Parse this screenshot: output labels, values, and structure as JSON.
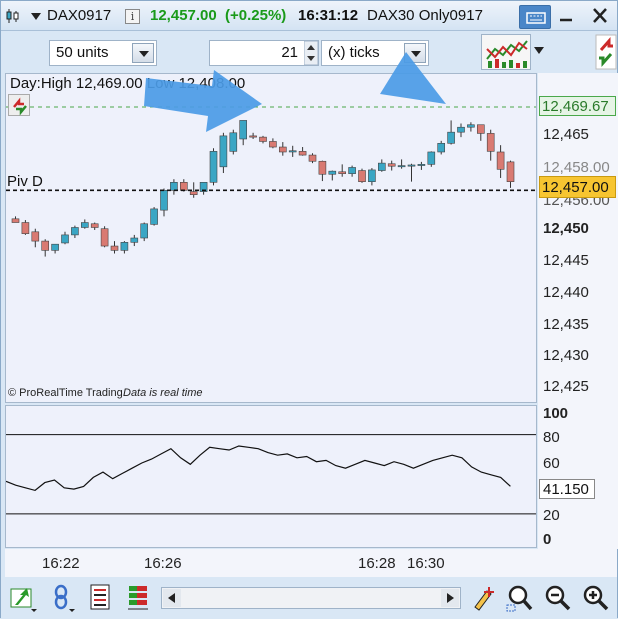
{
  "header": {
    "instrument": "DAX0917",
    "info_icon": "i",
    "price": "12,457.00",
    "change": "(+0.25%)",
    "time": "16:31:12",
    "description": "DAX30 Only0917"
  },
  "toolbar": {
    "units": "50 units",
    "ticks_value": "21",
    "ticks_mode": "(x) ticks"
  },
  "chart": {
    "day_info": "Day:High 12,469.00 Low 12,408.00",
    "piv_label": "Piv D",
    "copyright": "© ProRealTime Trading",
    "realtime": "Data is real time",
    "high_tag": "12,469.67",
    "last_tag": "12,457.00",
    "hidden_tags": [
      "12,458.00",
      "12,456.00"
    ],
    "price_ticks": [
      "12,465",
      "12,450",
      "12,445",
      "12,440",
      "12,435",
      "12,430",
      "12,425"
    ],
    "indicator_ticks": [
      "100",
      "80",
      "60",
      "20",
      "0"
    ],
    "indicator_value": "41.150",
    "time_ticks": [
      "16:22",
      "16:26",
      "16:28",
      "16:30"
    ]
  },
  "colors": {
    "up": "#3aa6c4",
    "down": "#d97a72",
    "accent_green": "#1a9a1a",
    "tag_yellow": "#f7c531",
    "arrow_blue": "#4b9be6"
  },
  "chart_data": {
    "type": "candlestick",
    "ylim": [
      12422,
      12475
    ],
    "high_line": 12469.67,
    "pivot": 12456.2,
    "candles": [
      [
        12451.6,
        12452,
        12451,
        12451
      ],
      [
        12451,
        12451.4,
        12449,
        12449.2
      ],
      [
        12449.5,
        12450,
        12447,
        12448
      ],
      [
        12448,
        12448.3,
        12445.5,
        12446.5
      ],
      [
        12446.5,
        12447.5,
        12446,
        12447.5
      ],
      [
        12447.7,
        12449.5,
        12447.5,
        12449
      ],
      [
        12449,
        12450.5,
        12448.5,
        12450.2
      ],
      [
        12450.2,
        12451.5,
        12450,
        12451
      ],
      [
        12450.8,
        12451,
        12449.8,
        12450.2
      ],
      [
        12450,
        12450.4,
        12447,
        12447.2
      ],
      [
        12447.2,
        12448,
        12446,
        12446.5
      ],
      [
        12446.5,
        12448,
        12446,
        12447.8
      ],
      [
        12447.8,
        12449,
        12447.2,
        12448.5
      ],
      [
        12448.5,
        12451,
        12448,
        12450.8
      ],
      [
        12450.7,
        12453.5,
        12450.5,
        12453.2
      ],
      [
        12453,
        12456.5,
        12452,
        12456.2
      ],
      [
        12456.2,
        12458,
        12455.5,
        12457.5
      ],
      [
        12457.5,
        12458,
        12456,
        12456.2
      ],
      [
        12456,
        12457.5,
        12455,
        12455.5
      ],
      [
        12456,
        12457.5,
        12455.5,
        12457.5
      ],
      [
        12457.5,
        12463,
        12457,
        12462.5
      ],
      [
        12460,
        12465.5,
        12459,
        12465
      ],
      [
        12462.5,
        12466,
        12462,
        12465.5
      ],
      [
        12464.5,
        12467.5,
        12463.5,
        12467.5
      ],
      [
        12465,
        12465.5,
        12464.5,
        12464.8
      ],
      [
        12464.8,
        12465,
        12463.8,
        12464.1
      ],
      [
        12464.1,
        12464.6,
        12463,
        12463.2
      ],
      [
        12463.2,
        12464,
        12461.8,
        12462.4
      ],
      [
        12462.4,
        12463.4,
        12461.6,
        12462.6
      ],
      [
        12462.5,
        12463.2,
        12461.8,
        12461.9
      ],
      [
        12461.9,
        12462.2,
        12460.6,
        12460.9
      ],
      [
        12460.9,
        12461,
        12457.7,
        12458.8
      ],
      [
        12458.8,
        12459.4,
        12457.8,
        12459.3
      ],
      [
        12459.2,
        12460.4,
        12458.4,
        12458.9
      ],
      [
        12458.9,
        12460.2,
        12458.4,
        12459.9
      ],
      [
        12459.4,
        12459.7,
        12457.4,
        12457.6
      ],
      [
        12457.6,
        12459.8,
        12457,
        12459.5
      ],
      [
        12459.4,
        12461.2,
        12459.2,
        12460.6
      ],
      [
        12460.5,
        12461,
        12459.4,
        12460.1
      ],
      [
        12460.1,
        12461.2,
        12459.7,
        12460.2
      ],
      [
        12460.2,
        12460.5,
        12457.6,
        12460.3
      ],
      [
        12460.4,
        12460.8,
        12459.5,
        12460.4
      ],
      [
        12460.4,
        12462.5,
        12460,
        12462.4
      ],
      [
        12462.4,
        12464.2,
        12462,
        12463.8
      ],
      [
        12463.8,
        12467.5,
        12463.6,
        12465.6
      ],
      [
        12465.6,
        12467,
        12464.8,
        12466.4
      ],
      [
        12466.4,
        12467.2,
        12465.7,
        12466.8
      ],
      [
        12466.8,
        12466.6,
        12464.2,
        12465.4
      ],
      [
        12465.4,
        12466,
        12461,
        12462.5
      ],
      [
        12462.4,
        12463.5,
        12458.2,
        12459.6
      ],
      [
        12460.8,
        12461,
        12456.6,
        12457.6
      ]
    ],
    "indicator": [
      45,
      42,
      40,
      38,
      44,
      46,
      40,
      39,
      41,
      48,
      52,
      47,
      51,
      55,
      59,
      62,
      66,
      70,
      63,
      58,
      65,
      71,
      70,
      69,
      72,
      71,
      70,
      67,
      65,
      66,
      63,
      64,
      60,
      61,
      57,
      55,
      58,
      61,
      59,
      57,
      60,
      58,
      55,
      58,
      61,
      63,
      65,
      63,
      56,
      52,
      50,
      48,
      41.15
    ]
  }
}
